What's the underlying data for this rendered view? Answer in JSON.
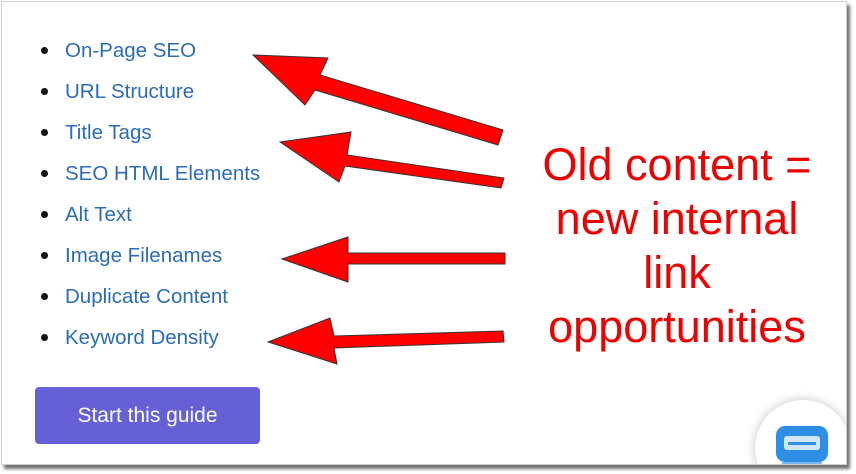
{
  "guide": {
    "links": [
      "On-Page SEO",
      "URL Structure",
      "Title Tags",
      "SEO HTML Elements",
      "Alt Text",
      "Image Filenames",
      "Duplicate Content",
      "Keyword Density"
    ],
    "cta_label": "Start this guide"
  },
  "annotation": {
    "lines": [
      "Old content =",
      "new internal",
      "link",
      "opportunities"
    ]
  },
  "icons": {
    "chat_widget": "chat-icon",
    "arrow": "arrow-icon"
  },
  "colors": {
    "link": "#2b6cb5",
    "cta_background": "#6660d6",
    "annotation": "#ee0000",
    "chat_widget": "#2f8fe6"
  }
}
